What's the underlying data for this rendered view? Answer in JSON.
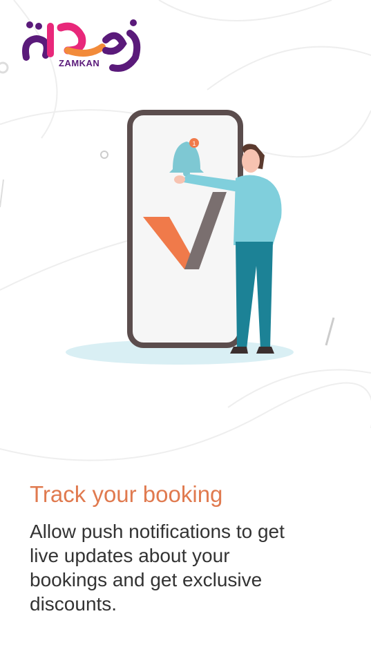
{
  "brand": {
    "logo_text": "ZAMKAN",
    "colors": {
      "logo_dark": "#5a1a7a",
      "logo_pink": "#e8287a",
      "logo_orange": "#f28b3a"
    }
  },
  "onboarding": {
    "title": "Track your booking",
    "description": "Allow push notifications to get live updates about your bookings and get exclusive discounts.",
    "notification_badge": "1",
    "colors": {
      "title": "#e07a4f",
      "text": "#333333",
      "accent": "#f07a4a"
    }
  },
  "illustration": {
    "name": "phone-with-person-and-bell"
  }
}
